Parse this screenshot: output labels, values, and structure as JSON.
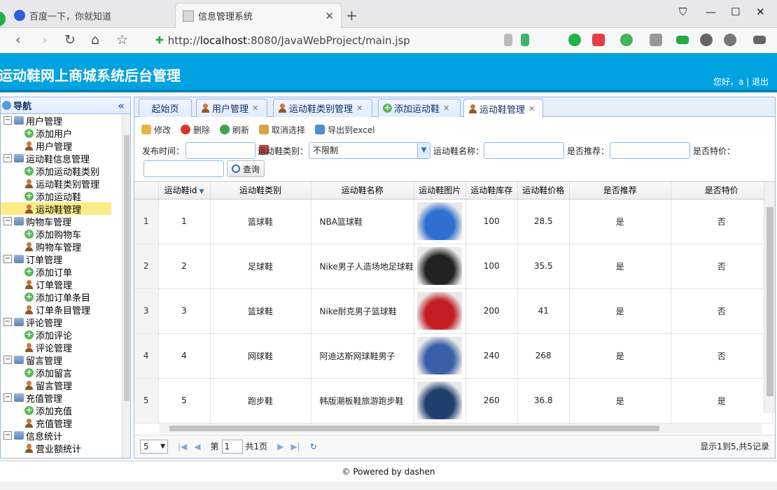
{
  "browser": {
    "tabs": [
      {
        "label": "百度一下，你就知道"
      },
      {
        "label": "信息管理系统"
      }
    ],
    "url_prefix": "http://",
    "url_host": "localhost",
    "url_rest": ":8080/JavaWebProject/main.jsp"
  },
  "app": {
    "title": "运动鞋网上商城系统后台管理",
    "greeting": "您好，a | 退出"
  },
  "sidebar": {
    "title": "导航",
    "groups": [
      {
        "label": "用户管理",
        "items": [
          "添加用户",
          "用户管理"
        ]
      },
      {
        "label": "运动鞋信息管理",
        "items": [
          "添加运动鞋类别",
          "运动鞋类别管理",
          "添加运动鞋",
          "运动鞋管理"
        ]
      },
      {
        "label": "购物车管理",
        "items": [
          "添加购物车",
          "购物车管理"
        ]
      },
      {
        "label": "订单管理",
        "items": [
          "添加订单",
          "订单管理",
          "添加订单条目",
          "订单条目管理"
        ]
      },
      {
        "label": "评论管理",
        "items": [
          "添加评论",
          "评论管理"
        ]
      },
      {
        "label": "留言管理",
        "items": [
          "添加留言",
          "留言管理"
        ]
      },
      {
        "label": "充值管理",
        "items": [
          "添加充值",
          "充值管理"
        ]
      },
      {
        "label": "信息统计",
        "items": [
          "营业额统计"
        ]
      }
    ]
  },
  "tabs": [
    "起始页",
    "用户管理",
    "运动鞋类别管理",
    "添加运动鞋",
    "运动鞋管理"
  ],
  "toolbar": {
    "edit": "修改",
    "delete": "删除",
    "refresh": "刷新",
    "cancel_select": "取消选择",
    "export": "导出到excel"
  },
  "filters": {
    "date_label": "发布时间：",
    "category_label": "运动鞋类别：",
    "category_value": "不限制",
    "name_label": "运动鞋名称：",
    "recommend_label": "是否推荐：",
    "special_label": "是否特价：",
    "query_button": "查询"
  },
  "table": {
    "headers": [
      "运动鞋id",
      "运动鞋类别",
      "运动鞋名称",
      "运动鞋图片",
      "运动鞋库存",
      "运动鞋价格",
      "是否推荐",
      "是否特价"
    ],
    "rows": [
      {
        "rn": "1",
        "id": "1",
        "category": "篮球鞋",
        "name": "NBA篮球鞋",
        "stock": "100",
        "price": "28.5",
        "recommend": "是",
        "special": "否",
        "img_color": "#2f6fd0"
      },
      {
        "rn": "2",
        "id": "2",
        "category": "足球鞋",
        "name": "Nike男子人造场地足球鞋",
        "stock": "100",
        "price": "35.5",
        "recommend": "是",
        "special": "否",
        "img_color": "#222222"
      },
      {
        "rn": "3",
        "id": "3",
        "category": "篮球鞋",
        "name": "Nike耐克男子篮球鞋",
        "stock": "200",
        "price": "41",
        "recommend": "是",
        "special": "否",
        "img_color": "#c41e24"
      },
      {
        "rn": "4",
        "id": "4",
        "category": "网球鞋",
        "name": "阿迪达斯网球鞋男子",
        "stock": "240",
        "price": "268",
        "recommend": "是",
        "special": "否",
        "img_color": "#3a5fa8"
      },
      {
        "rn": "5",
        "id": "5",
        "category": "跑步鞋",
        "name": "韩版潮板鞋旅游跑步鞋",
        "stock": "260",
        "price": "36.8",
        "recommend": "是",
        "special": "是",
        "img_color": "#1f3f6e"
      }
    ]
  },
  "pager": {
    "page_size": "5",
    "page_prefix": "第",
    "page_value": "1",
    "page_suffix": "共1页",
    "summary": "显示1到5,共5记录"
  },
  "footer": "© Powered by dashen"
}
